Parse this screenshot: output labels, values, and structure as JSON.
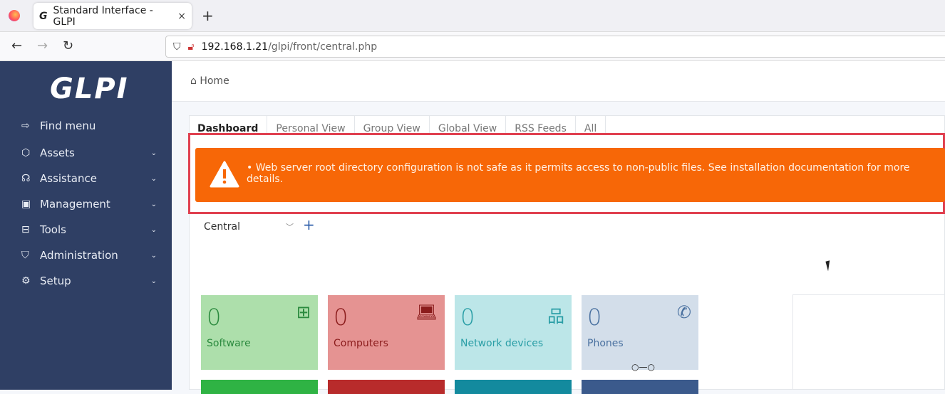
{
  "browser": {
    "tab_title": "Standard Interface - GLPI",
    "url_host": "192.168.1.21",
    "url_path": "/glpi/front/central.php"
  },
  "sidebar": {
    "logo": "GLPI",
    "items": [
      {
        "label": "Find menu",
        "icon": "arrow-right-icon",
        "chevron": false
      },
      {
        "label": "Assets",
        "icon": "cube-icon",
        "chevron": true
      },
      {
        "label": "Assistance",
        "icon": "headset-icon",
        "chevron": true
      },
      {
        "label": "Management",
        "icon": "wallet-icon",
        "chevron": true
      },
      {
        "label": "Tools",
        "icon": "briefcase-icon",
        "chevron": true
      },
      {
        "label": "Administration",
        "icon": "shield-icon",
        "chevron": true
      },
      {
        "label": "Setup",
        "icon": "gear-icon",
        "chevron": true
      }
    ]
  },
  "breadcrumb": {
    "home": "Home"
  },
  "tabs": [
    "Dashboard",
    "Personal View",
    "Group View",
    "Global View",
    "RSS Feeds",
    "All"
  ],
  "alert": {
    "message": "Web server root directory configuration is not safe as it permits access to non-public files. See installation documentation for more details.",
    "color": "#f76707"
  },
  "dashboard": {
    "selected": "Central",
    "tiles": [
      {
        "count": "0",
        "label": "Software",
        "bg": "#addfab",
        "fg": "#2b8a3e",
        "icon": "apps-add-icon"
      },
      {
        "count": "0",
        "label": "Computers",
        "bg": "#e59392",
        "fg": "#8b1c1c",
        "icon": "laptop-icon"
      },
      {
        "count": "0",
        "label": "Network devices",
        "bg": "#bce6e8",
        "fg": "#2a9ea6",
        "icon": "network-icon"
      },
      {
        "count": "0",
        "label": "Phones",
        "bg": "#d3deea",
        "fg": "#4a71a0",
        "icon": "phone-icon"
      }
    ],
    "row2_colors": [
      "#2fb344",
      "#b82b2b",
      "#138a9e",
      "#3b5a8c"
    ]
  }
}
